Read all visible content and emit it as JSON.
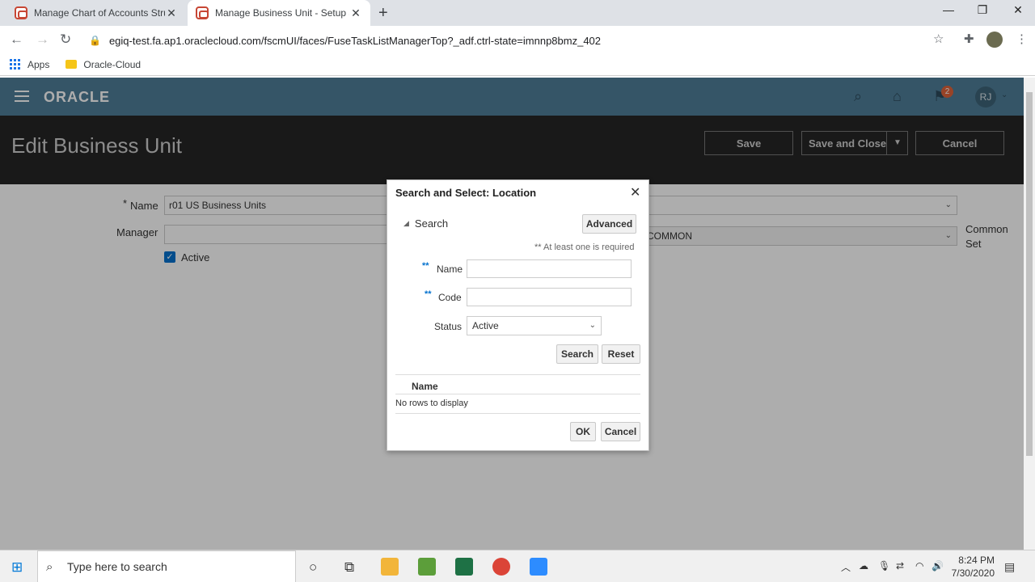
{
  "browser": {
    "tabs": [
      {
        "title": "Manage Chart of Accounts Struct",
        "active": false
      },
      {
        "title": "Manage Business Unit - Setup an",
        "active": true
      }
    ],
    "url": "egiq-test.fa.ap1.oraclecloud.com/fscmUI/faces/FuseTaskListManagerTop?_adf.ctrl-state=imnnp8bmz_402",
    "bookmarks": [
      "Apps",
      "Oracle-Cloud"
    ]
  },
  "header": {
    "logo": "ORACLE",
    "notification_count": "2",
    "user_initials": "RJ"
  },
  "page": {
    "title": "Edit Business Unit",
    "buttons": {
      "save": "Save",
      "save_close": "Save and Close",
      "cancel": "Cancel"
    }
  },
  "form": {
    "name_label": "Name",
    "name_required": "*",
    "name_value": "r01 US Business Units",
    "manager_label": "Manager",
    "active_label": "Active",
    "set_value": "COMMON",
    "set_label_1": "Common",
    "set_label_2": "Set"
  },
  "dialog": {
    "title": "Search and Select: Location",
    "search_label": "Search",
    "advanced": "Advanced",
    "required_note": "** At least one is required",
    "name_label": "Name",
    "code_label": "Code",
    "status_label": "Status",
    "status_value": "Active",
    "search_button": "Search",
    "reset_button": "Reset",
    "column_name": "Name",
    "no_rows": "No rows to display",
    "ok_button": "OK",
    "cancel_button": "Cancel",
    "required_marker": "**"
  },
  "taskbar": {
    "search_placeholder": "Type here to search",
    "time": "8:24 PM",
    "date": "7/30/2020"
  }
}
